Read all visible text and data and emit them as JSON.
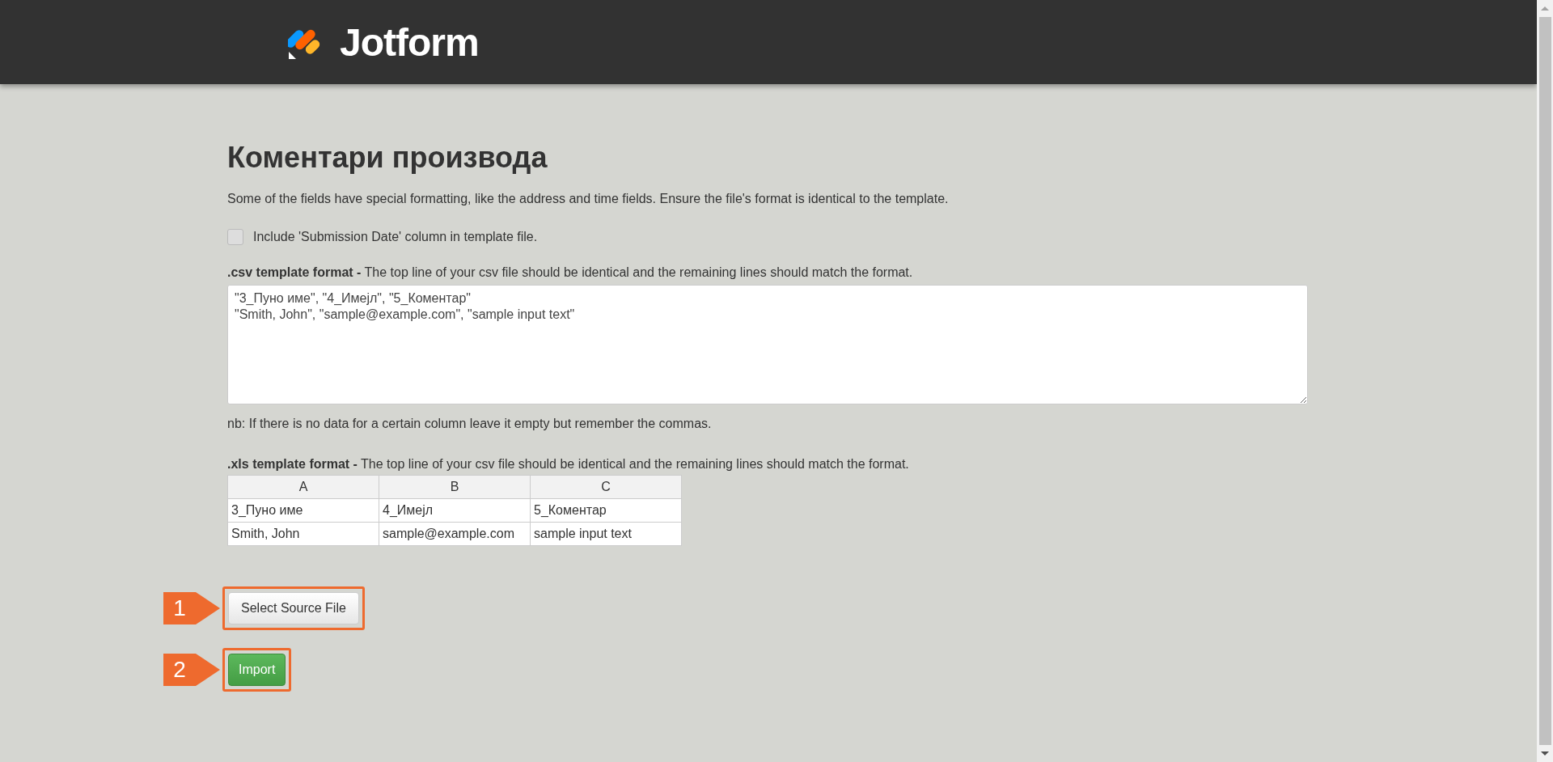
{
  "header": {
    "logo_text": "Jotform"
  },
  "title": "Коментари производа",
  "intro": "Some of the fields have special formatting, like the address and time fields. Ensure the file's format is identical to the template.",
  "include_date": {
    "label": "Include 'Submission Date' column in template file.",
    "checked": false
  },
  "csv": {
    "label": "**.csv template format -** The top line of your csv file should be identical and the remaining lines should match the format.",
    "value": "\"3_Пуно име\", \"4_Имејл\", \"5_Коментар\"\n\"Smith, John\", \"sample@example.com\", \"sample input text\"",
    "note": "nb: If there is no data for a certain column leave it empty but remember the commas."
  },
  "xls": {
    "label": "**.xls template format -** The top line of your csv file should be identical and the remaining lines should match the format.",
    "columns": [
      "A",
      "B",
      "C"
    ],
    "rows": [
      [
        "3_Пуно име",
        "4_Имејл",
        "5_Коментар"
      ],
      [
        "Smith, John",
        "sample@example.com",
        "sample input text"
      ]
    ]
  },
  "buttons": [
    {
      "label": "Select Source File",
      "kind": "default",
      "marker": "1"
    },
    {
      "label": "Import",
      "kind": "primary",
      "marker": "2"
    }
  ]
}
